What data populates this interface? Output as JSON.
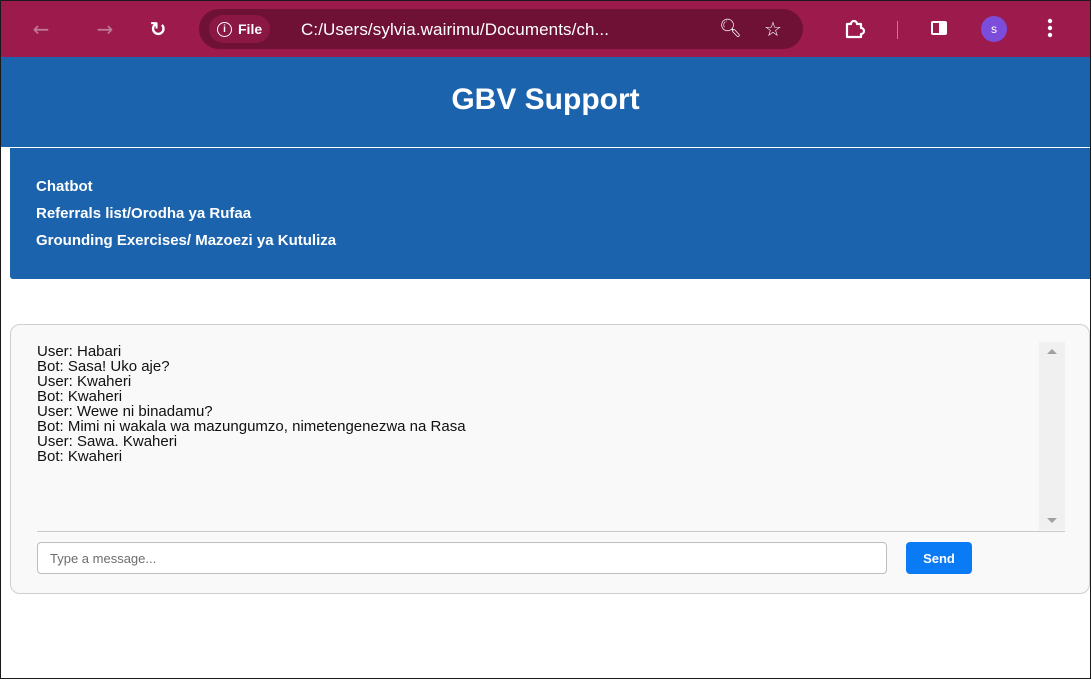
{
  "browser": {
    "file_label": "File",
    "url": "C:/Users/sylvia.wairimu/Documents/ch...",
    "profile_initial": "s",
    "theme_color": "#9c1b4c",
    "icons": [
      "back-arrow-icon",
      "forward-arrow-icon",
      "reload-icon",
      "info-icon",
      "zoom-icon",
      "bookmark-star-icon",
      "extensions-icon",
      "side-panel-icon",
      "menu-dots-icon"
    ]
  },
  "header": {
    "title": "GBV Support",
    "color": "#1b63ad"
  },
  "nav": {
    "links": [
      {
        "label": "Chatbot"
      },
      {
        "label": "Referrals list/Orodha ya Rufaa"
      },
      {
        "label": "Grounding Exercises/ Mazoezi ya Kutuliza"
      }
    ]
  },
  "chat": {
    "messages": [
      "User: Habari",
      "Bot: Sasa! Uko aje?",
      "User: Kwaheri",
      "Bot: Kwaheri",
      "User: Wewe ni binadamu?",
      "Bot: Mimi ni wakala wa mazungumzo, nimetengenezwa na Rasa",
      "User: Sawa. Kwaheri",
      "Bot: Kwaheri"
    ],
    "input_placeholder": "Type a message...",
    "input_value": "",
    "send_label": "Send",
    "send_color": "#0b7af5"
  }
}
